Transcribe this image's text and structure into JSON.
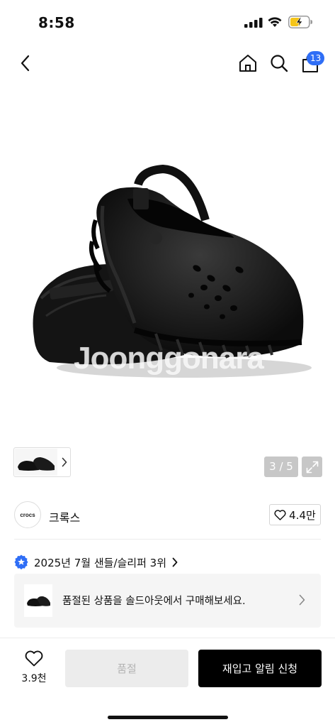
{
  "status_bar": {
    "time": "8:58",
    "battery_color": "#f5c518"
  },
  "header": {
    "icons": [
      "back-icon",
      "home-icon",
      "search-icon",
      "shopping-bag-icon"
    ],
    "cart_count": "13",
    "badge_color": "#2f6ef6"
  },
  "gallery": {
    "watermark": "Joonggonara",
    "page_indicator": "3 / 5",
    "product_color": "black"
  },
  "brand": {
    "logo_text": "crocs",
    "name": "크록스",
    "likes": "4.4만"
  },
  "ranking": {
    "label": "2025년 7월 샌들/슬리퍼 3위"
  },
  "notice": {
    "text": "품절된 상품을 솔드아웃에서 구매해보세요."
  },
  "bottom_bar": {
    "wish_count": "3.9천",
    "soldout_label": "품절",
    "restock_label": "재입고 알림 신청"
  }
}
